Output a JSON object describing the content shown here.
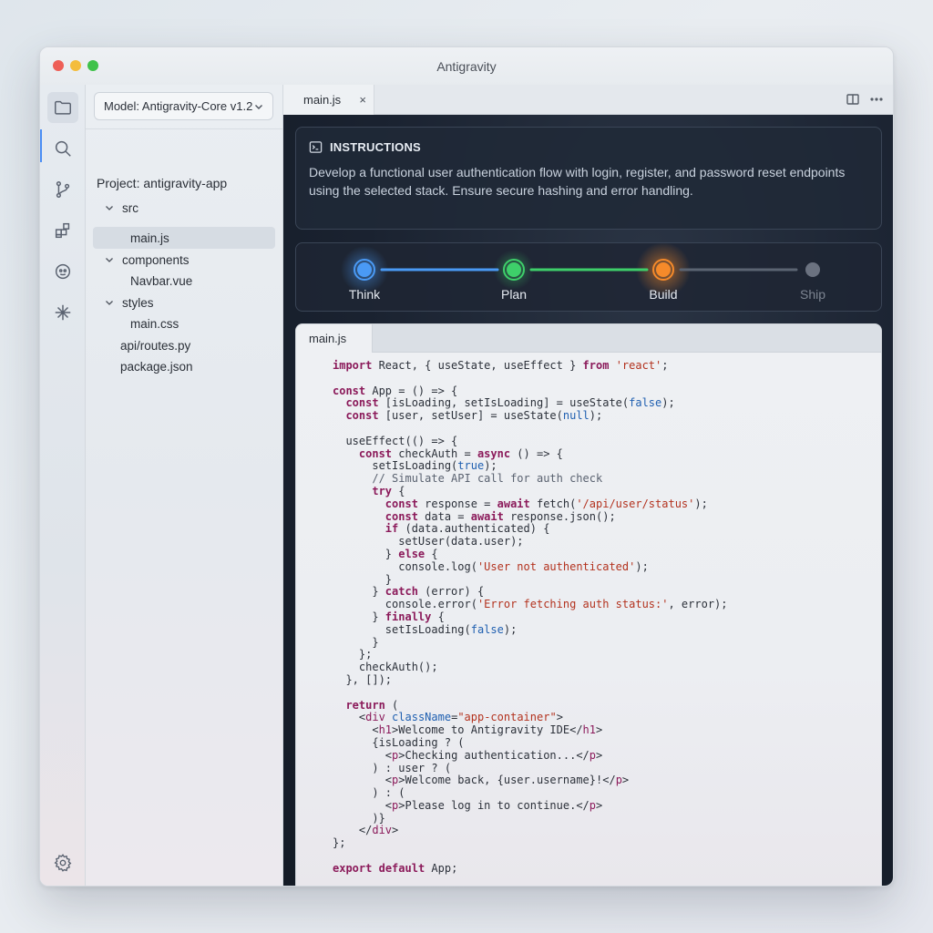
{
  "window": {
    "title": "Antigravity"
  },
  "activity_bar": {
    "icons": [
      "files-icon",
      "search-icon",
      "source-control-icon",
      "extensions-icon",
      "ai-agent-icon",
      "sparkle-icon"
    ],
    "bottom_icon": "settings-gear-icon"
  },
  "sidebar": {
    "model_label": "Model: Antigravity-Core v1.2",
    "project_title": "Project: antigravity-app",
    "tree": [
      {
        "label": "src",
        "type": "folder",
        "expanded": true
      },
      {
        "label": "main.js",
        "type": "file",
        "selected": true
      },
      {
        "label": "components",
        "type": "folder",
        "expanded": true
      },
      {
        "label": "Navbar.vue",
        "type": "file"
      },
      {
        "label": "styles",
        "type": "folder",
        "expanded": true
      },
      {
        "label": "main.css",
        "type": "file"
      },
      {
        "label": "api/routes.py",
        "type": "file"
      },
      {
        "label": "package.json",
        "type": "file"
      }
    ]
  },
  "editor": {
    "tab_label": "main.js",
    "tab_close": "×",
    "actions": [
      "split-editor-icon",
      "more-icon"
    ]
  },
  "instructions": {
    "heading": "INSTRUCTIONS",
    "body": "Develop a functional user authentication flow with login, register, and password reset endpoints using the selected stack. Ensure secure hashing and error handling."
  },
  "pipeline": {
    "stages": [
      {
        "label": "Think",
        "color": "#4a9af5",
        "state": "done"
      },
      {
        "label": "Plan",
        "color": "#3ecf6a",
        "state": "done"
      },
      {
        "label": "Build",
        "color": "#f58a2a",
        "state": "active"
      },
      {
        "label": "Ship",
        "color": "#6b7280",
        "state": "pending"
      }
    ]
  },
  "code_panel": {
    "tab_label": "main.js",
    "lines": [
      "import React, { useState, useEffect } from 'react';",
      "",
      "const App = () => {",
      "  const [isLoading, setIsLoading] = useState(false);",
      "  const [user, setUser] = useState(null);",
      "",
      "  useEffect(() => {",
      "    const checkAuth = async () => {",
      "      setIsLoading(true);",
      "      // Simulate API call for auth check",
      "      try {",
      "        const response = await fetch('/api/user/status');",
      "        const data = await response.json();",
      "        if (data.authenticated) {",
      "          setUser(data.user);",
      "        } else {",
      "          console.log('User not authenticated');",
      "        }",
      "      } catch (error) {",
      "        console.error('Error fetching auth status:', error);",
      "      } finally {",
      "        setIsLoading(false);",
      "      }",
      "    };",
      "    checkAuth();",
      "  }, []);",
      "",
      "  return (",
      "    <div className=\"app-container\">",
      "      <h1>Welcome to Antigravity IDE</h1>",
      "      {isLoading ? (",
      "        <p>Checking authentication...</p>",
      "      ) : user ? (",
      "        <p>Welcome back, {user.username}!</p>",
      "      ) : (",
      "        <p>Please log in to continue.</p>",
      "      )}",
      "    </div>",
      "};",
      "",
      "export default App;"
    ]
  }
}
